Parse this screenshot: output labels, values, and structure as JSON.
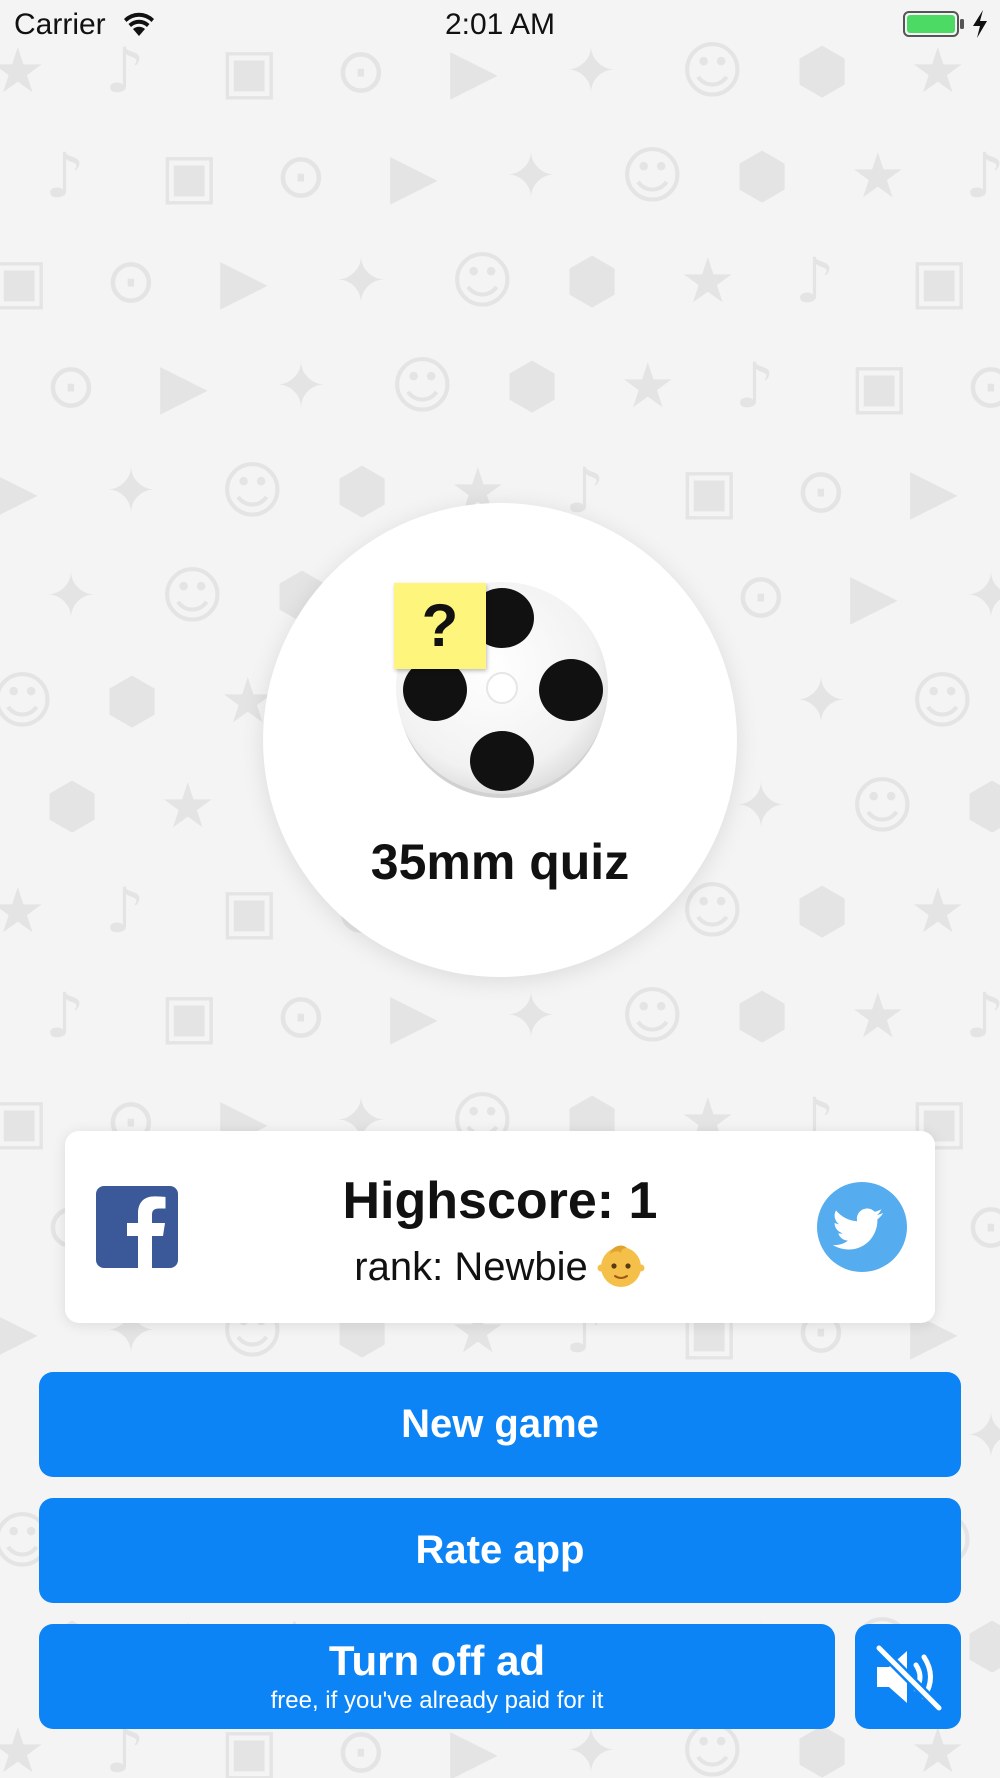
{
  "status_bar": {
    "carrier": "Carrier",
    "time": "2:01 AM",
    "icons": [
      "wifi-icon",
      "battery-icon",
      "charging-icon"
    ]
  },
  "logo": {
    "icon": "film-reel-icon",
    "badge": "?",
    "title": "35mm quiz"
  },
  "score_card": {
    "highscore": "Highscore: 1",
    "rank": "rank: Newbie",
    "rank_icon": "baby-face-emoji",
    "share_icons": [
      "facebook-icon",
      "twitter-icon"
    ]
  },
  "buttons": {
    "new_game": "New game",
    "rate_app": "Rate app",
    "turn_off_ad": "Turn off ad",
    "turn_off_ad_sub": "free, if you've already paid for it",
    "mute_icon": "speaker-muted-icon"
  },
  "colors": {
    "button_blue": "#0d84f6",
    "facebook_blue": "#3b5998",
    "twitter_blue": "#55acee",
    "note_yellow": "#fef67c",
    "battery_green": "#4cd964",
    "background": "#f4f4f4"
  }
}
